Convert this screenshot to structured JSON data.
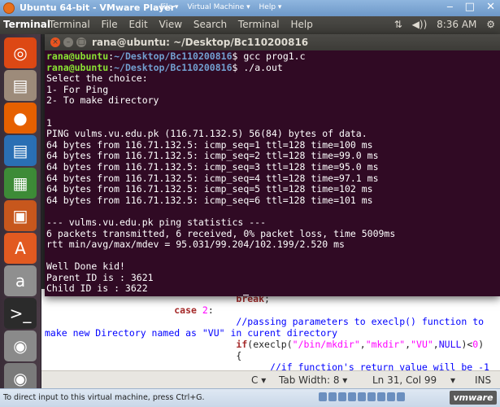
{
  "vmware": {
    "title": "Ubuntu 64-bit - VMware Player",
    "menus": [
      "File ▾",
      "Virtual Machine ▾",
      "Help ▾"
    ],
    "controls": [
      "‒",
      "□",
      "✕"
    ],
    "status_hint": "To direct input to this virtual machine, press Ctrl+G.",
    "brand": "vmware"
  },
  "panel": {
    "app_name": "Terminal",
    "menus": [
      "Terminal",
      "File",
      "Edit",
      "View",
      "Search",
      "Terminal",
      "Help"
    ],
    "indicators": {
      "network": "⇅",
      "sound": "◀))",
      "time": "8:36 AM",
      "settings": "⚙"
    }
  },
  "launcher": {
    "items": [
      {
        "name": "dash-home",
        "glyph": "◎",
        "color": "#dd4814"
      },
      {
        "name": "files",
        "glyph": "▤",
        "color": "#9d8b7a"
      },
      {
        "name": "firefox",
        "glyph": "●",
        "color": "#e66000"
      },
      {
        "name": "libreoffice-writer",
        "glyph": "▤",
        "color": "#2a6fb4"
      },
      {
        "name": "libreoffice-calc",
        "glyph": "▦",
        "color": "#3d8b37"
      },
      {
        "name": "libreoffice-impress",
        "glyph": "▣",
        "color": "#c7571d"
      },
      {
        "name": "software-center",
        "glyph": "A",
        "color": "#e25a21"
      },
      {
        "name": "amazon",
        "glyph": "a",
        "color": "#8f8f8f"
      },
      {
        "name": "terminal",
        "glyph": ">_",
        "color": "#2b2b2b"
      },
      {
        "name": "dvd",
        "glyph": "◉",
        "color": "#8a8a8a"
      },
      {
        "name": "dvd-2",
        "glyph": "◉",
        "color": "#7a7a7a"
      }
    ]
  },
  "terminal": {
    "title": "rana@ubuntu: ~/Desktop/Bc110200816",
    "user_host": "rana@ubuntu",
    "path": "~/Desktop/Bc110200816",
    "lines": [
      {
        "type": "prompt",
        "cmd": " gcc prog1.c"
      },
      {
        "type": "prompt",
        "cmd": " ./a.out"
      },
      {
        "type": "out",
        "text": "Select the choice:"
      },
      {
        "type": "out",
        "text": "1- For Ping"
      },
      {
        "type": "out",
        "text": "2- To make directory"
      },
      {
        "type": "out",
        "text": ""
      },
      {
        "type": "out",
        "text": "1"
      },
      {
        "type": "out",
        "text": "PING vulms.vu.edu.pk (116.71.132.5) 56(84) bytes of data."
      },
      {
        "type": "out",
        "text": "64 bytes from 116.71.132.5: icmp_seq=1 ttl=128 time=100 ms"
      },
      {
        "type": "out",
        "text": "64 bytes from 116.71.132.5: icmp_seq=2 ttl=128 time=99.0 ms"
      },
      {
        "type": "out",
        "text": "64 bytes from 116.71.132.5: icmp_seq=3 ttl=128 time=95.0 ms"
      },
      {
        "type": "out",
        "text": "64 bytes from 116.71.132.5: icmp_seq=4 ttl=128 time=97.1 ms"
      },
      {
        "type": "out",
        "text": "64 bytes from 116.71.132.5: icmp_seq=5 ttl=128 time=102 ms"
      },
      {
        "type": "out",
        "text": "64 bytes from 116.71.132.5: icmp_seq=6 ttl=128 time=101 ms"
      },
      {
        "type": "out",
        "text": ""
      },
      {
        "type": "out",
        "text": "--- vulms.vu.edu.pk ping statistics ---"
      },
      {
        "type": "out",
        "text": "6 packets transmitted, 6 received, 0% packet loss, time 5009ms"
      },
      {
        "type": "out",
        "text": "rtt min/avg/max/mdev = 95.031/99.204/102.199/2.520 ms"
      },
      {
        "type": "out",
        "text": ""
      },
      {
        "type": "out",
        "text": "Well Done kid!"
      },
      {
        "type": "out",
        "text": "Parent ID is : 3621"
      },
      {
        "type": "out",
        "text": "Child ID is : 3622"
      },
      {
        "type": "prompt",
        "cmd": " ",
        "cursor": true
      }
    ]
  },
  "editor": {
    "code_lines": [
      [
        {
          "c": "",
          "t": "                                  "
        },
        {
          "c": "kw",
          "t": "break"
        },
        {
          "c": "",
          "t": ";"
        }
      ],
      [
        {
          "c": "",
          "t": "                       "
        },
        {
          "c": "kw",
          "t": "case"
        },
        {
          "c": "",
          "t": " "
        },
        {
          "c": "st",
          "t": "2"
        },
        {
          "c": "",
          "t": ":"
        }
      ],
      [
        {
          "c": "",
          "t": "                                  "
        },
        {
          "c": "cm",
          "t": "//passing parameters to execlp() function to"
        }
      ],
      [
        {
          "c": "cm",
          "t": "make new Directory named as \"VU\" in curent directory"
        }
      ],
      [
        {
          "c": "",
          "t": "                                  "
        },
        {
          "c": "kw",
          "t": "if"
        },
        {
          "c": "",
          "t": "(execlp("
        },
        {
          "c": "st",
          "t": "\"/bin/mkdir\""
        },
        {
          "c": "",
          "t": ","
        },
        {
          "c": "st",
          "t": "\"mkdir\""
        },
        {
          "c": "",
          "t": ","
        },
        {
          "c": "st",
          "t": "\"VU\""
        },
        {
          "c": "",
          "t": ","
        },
        {
          "c": "id",
          "t": "NULL"
        },
        {
          "c": "",
          "t": ")<"
        },
        {
          "c": "st",
          "t": "0"
        },
        {
          "c": "",
          "t": ")"
        }
      ],
      [
        {
          "c": "",
          "t": "                                  {"
        }
      ],
      [
        {
          "c": "",
          "t": "                                        "
        },
        {
          "c": "cm",
          "t": "//if function's return value will be -1"
        }
      ]
    ],
    "status": {
      "language": "C ▾",
      "tab_width": "Tab Width: 8 ▾",
      "position": "Ln 31, Col 99",
      "mode_arrow": "▾",
      "insert": "INS"
    }
  }
}
